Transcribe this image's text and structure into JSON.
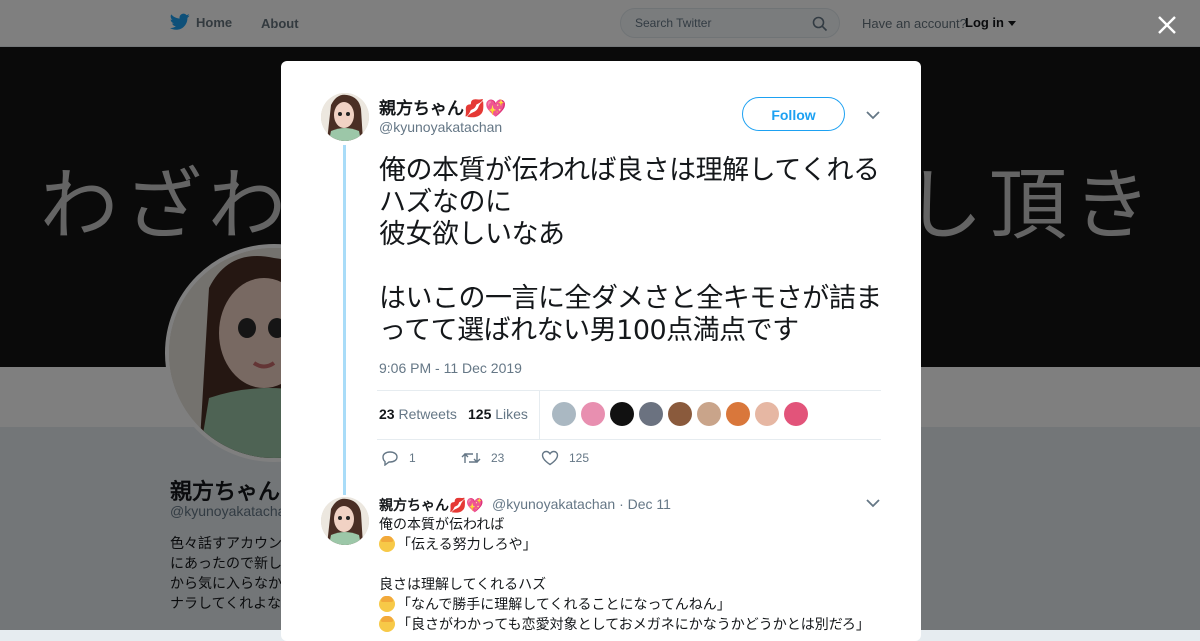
{
  "header": {
    "home_label": "Home",
    "about_label": "About",
    "search_placeholder": "Search Twitter",
    "have_account": "Have an account?",
    "login_label": "Log in"
  },
  "background_profile": {
    "banner_text_left": "わざわ",
    "banner_text_right": "し頂き",
    "name": "親方ちゃん",
    "handle": "@kyunoyakatachan",
    "bio_lines": [
      "色々話すアカウン",
      "にあったので新し",
      "から気に入らなか",
      "ナラしてくれよな"
    ]
  },
  "tweet": {
    "display_name": "親方ちゃん💋💖",
    "handle": "@kyunoyakatachan",
    "follow_label": "Follow",
    "text": "俺の本質が伝われば良さは理解してくれるハズなのに\n彼女欲しいなあ\n\nはいこの一言に全ダメさと全キモさが詰まってて選ばれない男100点満点です",
    "timestamp": "9:06 PM - 11 Dec 2019",
    "retweets_count": "23",
    "retweets_label": "Retweets",
    "likes_count": "125",
    "likes_label": "Likes",
    "likers": [
      {
        "icon": "default-avatar",
        "color": "#aab8c2"
      },
      {
        "icon": "pink-hair-avatar",
        "color": "#e88fb0"
      },
      {
        "icon": "dark-avatar",
        "color": "#111111"
      },
      {
        "icon": "mountain-avatar",
        "color": "#6b7280"
      },
      {
        "icon": "brown-avatar",
        "color": "#8a5a3c"
      },
      {
        "icon": "woman-avatar",
        "color": "#c9a48a"
      },
      {
        "icon": "food-avatar",
        "color": "#d9773b"
      },
      {
        "icon": "anime-avatar",
        "color": "#e6b7a3"
      },
      {
        "icon": "pink-anime-avatar",
        "color": "#e2547a"
      }
    ],
    "reply_count": "1",
    "retweet_action_count": "23",
    "like_action_count": "125"
  },
  "reply": {
    "display_name": "親方ちゃん💋💖",
    "handle": "@kyunoyakatachan",
    "date": "· Dec 11",
    "lines": [
      "俺の本質が伝われば",
      "「伝える努力しろや」",
      "",
      "良さは理解してくれるハズ",
      "「なんで勝手に理解してくれることになってんねん」",
      "「良さがわかっても恋愛対象としておメガネにかなうかどうかとは別だろ」"
    ]
  },
  "colors": {
    "accent": "#1da1f2",
    "thread": "#a9dcf8",
    "muted": "#657786"
  }
}
